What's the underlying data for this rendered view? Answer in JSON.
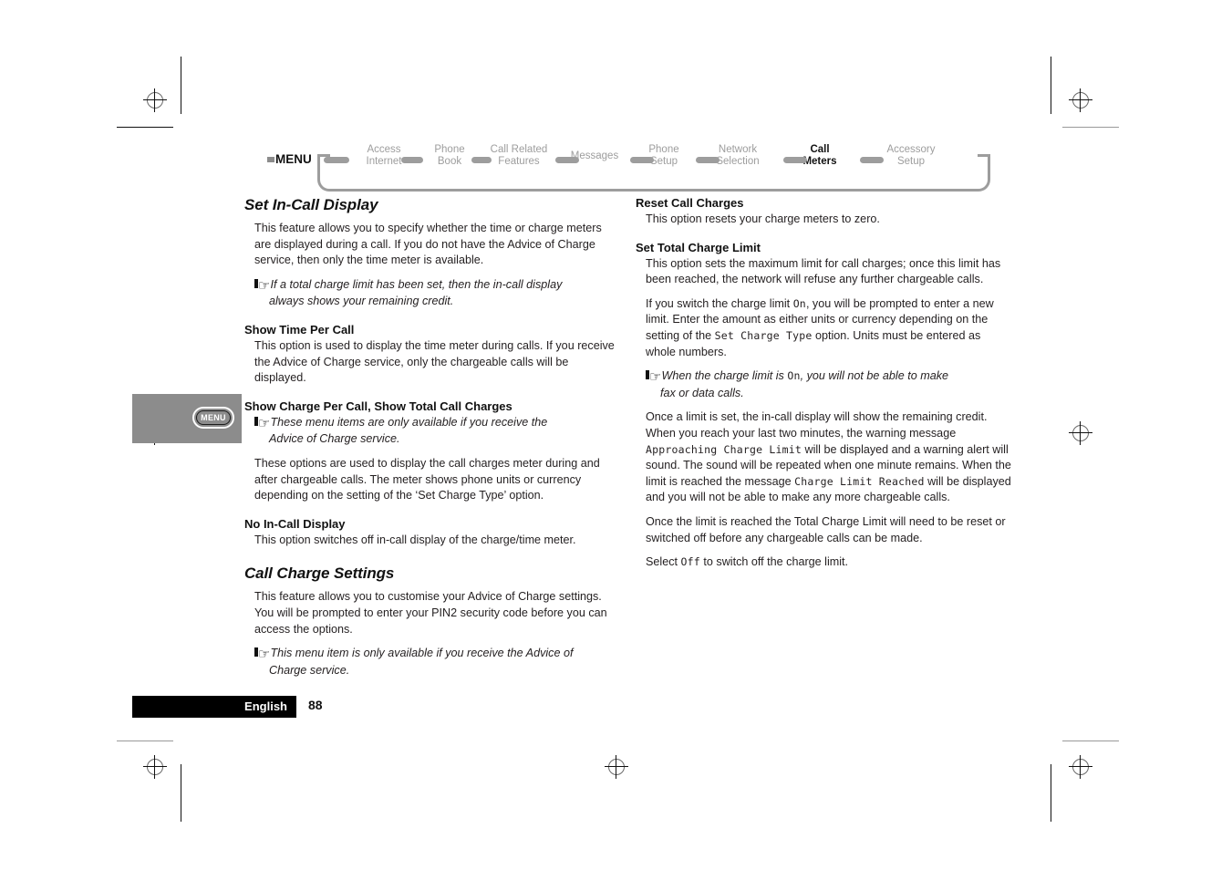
{
  "nav": {
    "menu_label": "MENU",
    "items": [
      {
        "line1": "Access",
        "line2": "Internet",
        "active": false
      },
      {
        "line1": "Phone",
        "line2": "Book",
        "active": false
      },
      {
        "line1": "Call Related",
        "line2": "Features",
        "active": false
      },
      {
        "line1": "Messages",
        "line2": "",
        "active": false
      },
      {
        "line1": "Phone",
        "line2": "Setup",
        "active": false
      },
      {
        "line1": "Network",
        "line2": "Selection",
        "active": false
      },
      {
        "line1": "Call",
        "line2": "Meters",
        "active": true
      },
      {
        "line1": "Accessory",
        "line2": "Setup",
        "active": false
      }
    ]
  },
  "side_tab": {
    "label": "MENU"
  },
  "left_column": {
    "heading": "Set In-Call Display",
    "para1": "This feature allows you to specify whether the time or charge meters are displayed during a call. If you do not have the Advice of Charge service, then only the time meter is available.",
    "note1_main": "If a total charge limit has been set, then the in-call display",
    "note1_cont": "always shows your remaining credit.",
    "sub1": "Show Time Per Call",
    "para2": "This option is used to display the time meter during calls. If you receive the Advice of Charge service, only the chargeable calls will be displayed.",
    "sub2": "Show Charge Per Call, Show Total Call Charges",
    "note2_main": "These menu items are only available if you receive the",
    "note2_cont": "Advice of Charge service.",
    "para3": "These options are used to display the call charges meter during and after chargeable calls. The meter shows phone units or currency depending on the setting of the ‘Set Charge Type’ option.",
    "sub3": "No In-Call Display",
    "para4": "This option switches off in-call display of the charge/time meter.",
    "heading2": "Call Charge Settings",
    "para5": "This feature allows you to customise your Advice of Charge settings. You will be prompted to enter your PIN2 security code before you can access the options.",
    "note3_main": "This menu item is only available if you receive the Advice of",
    "note3_cont": "Charge service."
  },
  "right_column": {
    "sub1": "Reset Call Charges",
    "para1": "This option resets your charge meters to zero.",
    "sub2": "Set Total Charge Limit",
    "para2": "This option sets the maximum limit for call charges; once this limit has been reached, the network will refuse any further chargeable calls.",
    "para3_a": "If you switch the charge limit ",
    "para3_lcd1": "On",
    "para3_b": ", you will be prompted to enter a new limit. Enter the amount as either units or currency depending on the setting of the ",
    "para3_lcd2": "Set Charge Type",
    "para3_c": " option. Units must be entered as whole numbers.",
    "note1_a": "When the charge limit is ",
    "note1_lcd": "On",
    "note1_b": ", you will not be able to make",
    "note1_cont": "fax or data calls.",
    "para4_a": "Once a limit is set, the in-call display will show the remaining credit. When you reach your last two minutes, the warning message ",
    "para4_lcd1": "Approaching Charge Limit",
    "para4_b": " will be displayed and a warning alert will sound. The sound will be repeated when one minute remains. When the limit is reached the message ",
    "para4_lcd2": "Charge Limit Reached",
    "para4_c": "  will be displayed and you will not be able to make any more chargeable calls.",
    "para5": "Once the limit is reached the Total Charge Limit will need to be reset or switched off before any chargeable calls can be made.",
    "para6_a": "Select ",
    "para6_lcd": "Off",
    "para6_b": " to switch off the charge limit."
  },
  "footer": {
    "language": "English",
    "page_number": "88"
  },
  "colors": {
    "nav_inactive": "#9d9d9d",
    "nav_active": "#111111",
    "side_tab_gray": "#8c8c8c",
    "footer_black": "#000000",
    "body_text": "#231f20"
  }
}
